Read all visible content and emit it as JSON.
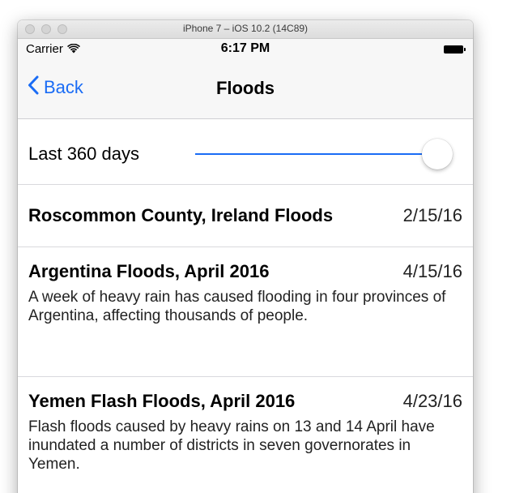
{
  "window": {
    "title": "iPhone 7 – iOS 10.2 (14C89)"
  },
  "statusbar": {
    "carrier": "Carrier",
    "time": "6:17 PM"
  },
  "navbar": {
    "back_label": "Back",
    "title": "Floods"
  },
  "filter": {
    "label": "Last 360 days",
    "slider_value_fraction": 1.0
  },
  "events": [
    {
      "title": "Roscommon County, Ireland Floods",
      "date": "2/15/16",
      "description": ""
    },
    {
      "title": "Argentina Floods, April 2016",
      "date": "4/15/16",
      "description": "A week of heavy rain has caused flooding in four provinces of Argentina, affecting thousands of people."
    },
    {
      "title": "Yemen Flash Floods, April 2016",
      "date": "4/23/16",
      "description": "Flash floods caused by heavy rains on 13 and 14 April have inundated a number of districts in seven governorates in Yemen."
    }
  ],
  "colors": {
    "accent": "#1a6cf5",
    "bar_background": "#f7f7f7",
    "separator": "#d9d9dd"
  }
}
